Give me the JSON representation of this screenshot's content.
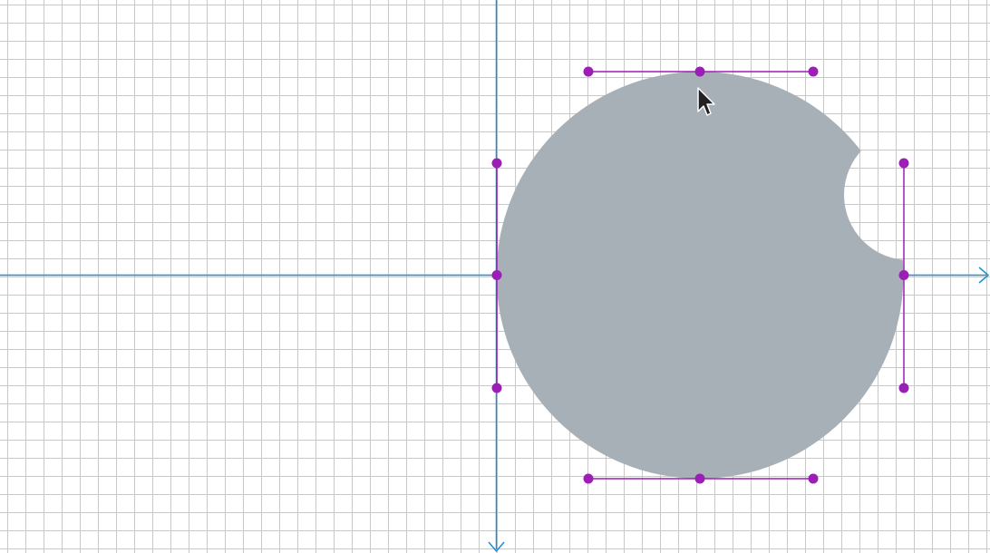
{
  "canvas": {
    "grid_color": "#c8c8c8",
    "background_color": "#ffffff"
  },
  "axes": {
    "color": "#1a8fd6",
    "x_axis": "x-axis",
    "y_axis": "y-axis",
    "x_arrow_icon": "arrow-right-icon",
    "y_arrow_icon": "arrow-down-icon"
  },
  "shape": {
    "kind": "circle-with-bite",
    "fill_color": "#a8b0b7"
  },
  "selection": {
    "handle_color": "#9b1fb5",
    "handles": [
      "control-handle-top-left",
      "control-handle-top-center",
      "control-handle-top-right",
      "control-handle-left-top",
      "control-handle-left-middle",
      "control-handle-left-bottom",
      "control-handle-right-top",
      "control-handle-right-middle",
      "control-handle-right-bottom",
      "control-handle-bottom-left",
      "control-handle-bottom-center",
      "control-handle-bottom-right"
    ]
  },
  "cursor": {
    "icon": "mouse-pointer-icon"
  }
}
